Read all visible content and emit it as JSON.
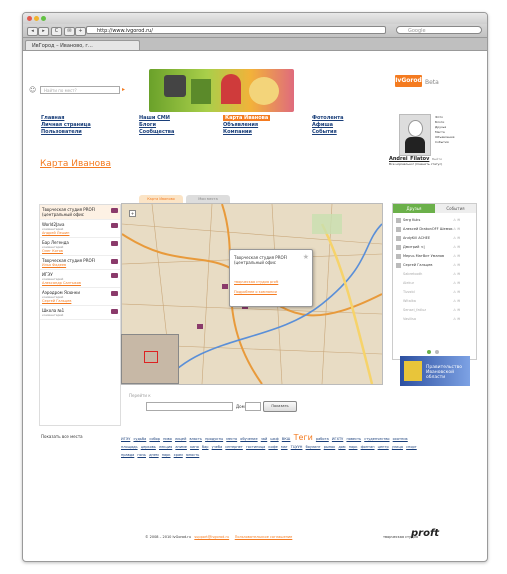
{
  "browser": {
    "back": "◂",
    "forward": "▸",
    "reload": "C",
    "url": "http://www.ivgorod.ru/",
    "search_placeholder": "Google",
    "tab_title": "ИвГород – Иваново, г..."
  },
  "site": {
    "search_placeholder": "Найти по мест?",
    "logo_text": "IvGorod",
    "beta": "Beta"
  },
  "nav": {
    "col1": [
      "Главная",
      "Личная страница",
      "Пользователи"
    ],
    "col2": [
      "Наши СМИ",
      "Блоги",
      "Сообщества"
    ],
    "col3": [
      "Карта Иванова",
      "Объявления",
      "Компании"
    ],
    "col4": [
      "Фотолента",
      "Афиша",
      "События"
    ]
  },
  "user": {
    "menu": [
      "Фото",
      "Блоги",
      "Друзья",
      "Места",
      "Объявления",
      "События"
    ],
    "name": "Andrei_Filatov",
    "exit": "Выйти",
    "status": "Все нормально! (Сменить статус)"
  },
  "page": {
    "title": "Карта Иванова",
    "tab_map": "Карта Иваново",
    "tab_my": "Мои места"
  },
  "places": [
    {
      "title": "Творческая студия PROFI (центральный офис",
      "link": ""
    },
    {
      "title": "World2Java",
      "comments": "комментарий",
      "link": "Андрей Лешин"
    },
    {
      "title": "Бар Легенда",
      "comments": "комментарий",
      "link": "Олег Котов"
    },
    {
      "title": "Творческая студия PROFI",
      "comments": "",
      "link": "Илья Фадеев"
    },
    {
      "title": "ИГЭУ",
      "comments": "комментарий",
      "link": "Александр Салтыков"
    },
    {
      "title": "Аэродром Ясюнки",
      "comments": "комментарий",
      "link": "Сергей Гальцев"
    },
    {
      "title": "Школа №1",
      "comments": "комментарий",
      "link": ""
    }
  ],
  "map": {
    "popup_title": "Творческая студия PROFI (центральный офис",
    "popup_link1": "творческая студия proft",
    "popup_link2": "Подробнее о компании",
    "address_label": "Перейти к",
    "dom_label": "Дом",
    "find_button": "Показать",
    "all_places": "Показать все места"
  },
  "tags": {
    "words": [
      "ИГЭУ",
      "судьба",
      "собор",
      "пиво",
      "лицей",
      "власть",
      "продукты",
      "место",
      "обучение",
      "чай",
      "шкф",
      "ВКШ",
      "Теги",
      "работа",
      "ИГХТУ",
      "повесть",
      "студенчество",
      "охотник",
      "площадь",
      "церковь",
      "лекция",
      "аниме",
      "кино",
      "бар",
      "учеба",
      "интернет",
      "гостиница",
      "кофе",
      "маг",
      "ТЦУУН",
      "боулинг",
      "рынок",
      "дом",
      "парк",
      "фонтан",
      "центр",
      "улица",
      "спорт",
      "правда",
      "ночь",
      "днем",
      "парк",
      "храм",
      "юность"
    ],
    "big_index": 12
  },
  "friends": {
    "tab_friends": "Друзья",
    "tab_events": "События",
    "online": [
      "Serg Kuks",
      "Алексей DrakonOFF Шемяк",
      "AndyKill ACHEE",
      "Дмитрий <|",
      "Мерчь МатВит Уманов",
      "Сергей Гальцев"
    ],
    "offline": [
      "Sabretooth",
      "Alekur",
      "Tizzzbl",
      "Witalka",
      "Sensei_fatluz",
      "Vasilisa"
    ]
  },
  "ad": {
    "text": "Правительство Ивановской области"
  },
  "footer": {
    "copyright": "© 2008 – 2010 IvGorod.ru",
    "email": "support@ivgorod.ru",
    "agreement": "Пользовательское соглашение",
    "studio": "творческая студия",
    "studio_logo": "proft"
  },
  "colors": {
    "accent": "#f47b20",
    "link": "#1a3f7a"
  }
}
